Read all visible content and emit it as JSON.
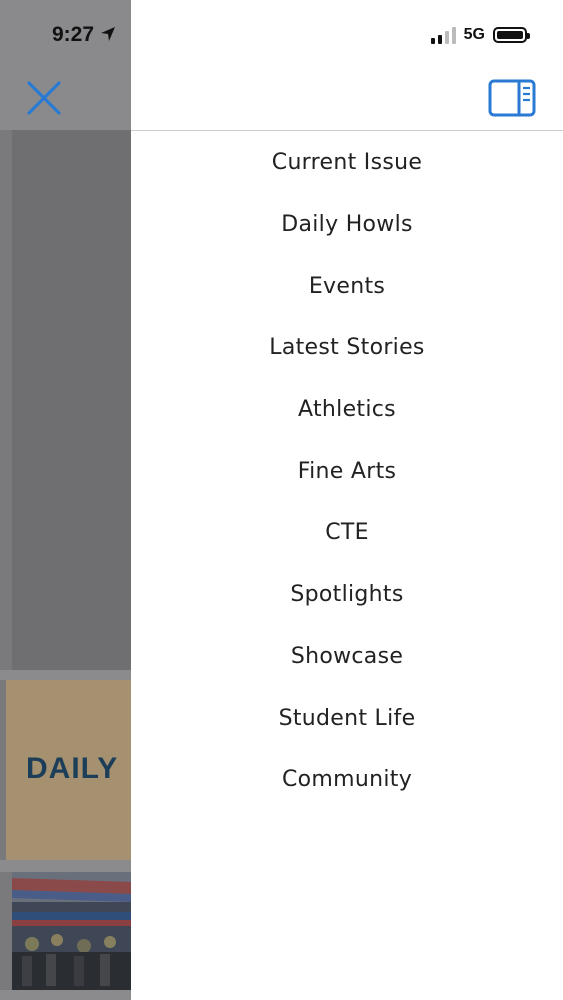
{
  "status_bar": {
    "time": "9:27",
    "network": "5G",
    "icons": [
      "location-arrow-icon",
      "signal-bars-icon",
      "battery-icon"
    ]
  },
  "header": {
    "close_icon": "close-icon",
    "panel_icon": "sidebar-panel-icon",
    "accent_color": "#2a7ad4"
  },
  "background": {
    "card_text": "DAILY"
  },
  "menu": {
    "items": [
      {
        "label": "Current Issue"
      },
      {
        "label": "Daily Howls"
      },
      {
        "label": "Events"
      },
      {
        "label": "Latest Stories"
      },
      {
        "label": "Athletics"
      },
      {
        "label": "Fine Arts"
      },
      {
        "label": "CTE"
      },
      {
        "label": "Spotlights"
      },
      {
        "label": "Showcase"
      },
      {
        "label": "Student Life"
      },
      {
        "label": "Community"
      }
    ]
  }
}
